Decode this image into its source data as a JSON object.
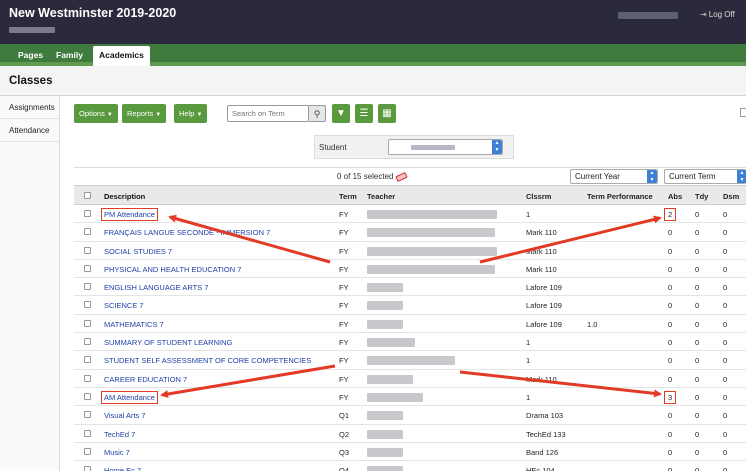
{
  "header": {
    "title": "New Westminster 2019-2020",
    "logoff": "Log Off"
  },
  "tabs": [
    {
      "label": "Pages"
    },
    {
      "label": "Family"
    },
    {
      "label": "Academics"
    }
  ],
  "page": {
    "title": "Classes"
  },
  "side_nav": [
    {
      "label": "Assignments"
    },
    {
      "label": "Attendance"
    }
  ],
  "toolbar": {
    "options": "Options",
    "reports": "Reports",
    "help": "Help",
    "search_placeholder": "Search on Term"
  },
  "student_filter": {
    "label": "Student"
  },
  "selection": {
    "count_text": "0 of 15 selected",
    "year_filter": "Current Year",
    "term_filter": "Current Term"
  },
  "table": {
    "columns": [
      "Description",
      "Term",
      "Teacher",
      "Clssrm",
      "Term Performance",
      "Abs",
      "Tdy",
      "Dsm"
    ],
    "rows": [
      {
        "desc": "PM Attendance",
        "term": "FY",
        "room": "1",
        "perf": "",
        "abs": "2",
        "tdy": "0",
        "dsm": "0"
      },
      {
        "desc": "FRANÇAIS LANGUE SECONDE - IMMERSION 7",
        "term": "FY",
        "room": "Mark 110",
        "perf": "",
        "abs": "0",
        "tdy": "0",
        "dsm": "0"
      },
      {
        "desc": "SOCIAL STUDIES 7",
        "term": "FY",
        "room": "Mark 110",
        "perf": "",
        "abs": "0",
        "tdy": "0",
        "dsm": "0"
      },
      {
        "desc": "PHYSICAL AND HEALTH EDUCATION 7",
        "term": "FY",
        "room": "Mark 110",
        "perf": "",
        "abs": "0",
        "tdy": "0",
        "dsm": "0"
      },
      {
        "desc": "ENGLISH LANGUAGE ARTS 7",
        "term": "FY",
        "room": "Lafore 109",
        "perf": "",
        "abs": "0",
        "tdy": "0",
        "dsm": "0"
      },
      {
        "desc": "SCIENCE 7",
        "term": "FY",
        "room": "Lafore 109",
        "perf": "",
        "abs": "0",
        "tdy": "0",
        "dsm": "0"
      },
      {
        "desc": "MATHEMATICS 7",
        "term": "FY",
        "room": "Lafore 109",
        "perf": "1.0",
        "abs": "0",
        "tdy": "0",
        "dsm": "0"
      },
      {
        "desc": "SUMMARY OF STUDENT LEARNING",
        "term": "FY",
        "room": "1",
        "perf": "",
        "abs": "0",
        "tdy": "0",
        "dsm": "0"
      },
      {
        "desc": "STUDENT SELF ASSESSMENT OF CORE COMPETENCIES",
        "term": "FY",
        "room": "1",
        "perf": "",
        "abs": "0",
        "tdy": "0",
        "dsm": "0"
      },
      {
        "desc": "CAREER EDUCATION 7",
        "term": "FY",
        "room": "Mark 110",
        "perf": "",
        "abs": "0",
        "tdy": "0",
        "dsm": "0"
      },
      {
        "desc": "AM Attendance",
        "term": "FY",
        "room": "1",
        "perf": "",
        "abs": "3",
        "tdy": "0",
        "dsm": "0"
      },
      {
        "desc": "Visual Arts 7",
        "term": "Q1",
        "room": "Drama 103",
        "perf": "",
        "abs": "0",
        "tdy": "0",
        "dsm": "0"
      },
      {
        "desc": "TechEd 7",
        "term": "Q2",
        "room": "TechEd 133",
        "perf": "",
        "abs": "0",
        "tdy": "0",
        "dsm": "0"
      },
      {
        "desc": "Music 7",
        "term": "Q3",
        "room": "Band 126",
        "perf": "",
        "abs": "0",
        "tdy": "0",
        "dsm": "0"
      },
      {
        "desc": "Home Ec 7",
        "term": "Q4",
        "room": "HEc 104",
        "perf": "",
        "abs": "0",
        "tdy": "0",
        "dsm": "0"
      }
    ]
  },
  "colors": {
    "header_bg": "#2a2a3c",
    "tab_green": "#3f7a3f",
    "button_green": "#5a9a3e",
    "link_blue": "#1f3fa8",
    "annotation_red": "#e23a24"
  },
  "icons": [
    "search-icon",
    "filter-icon",
    "list-view-icon",
    "card-view-icon",
    "eraser-icon",
    "logoff-icon",
    "dropdown-arrow-icon"
  ]
}
